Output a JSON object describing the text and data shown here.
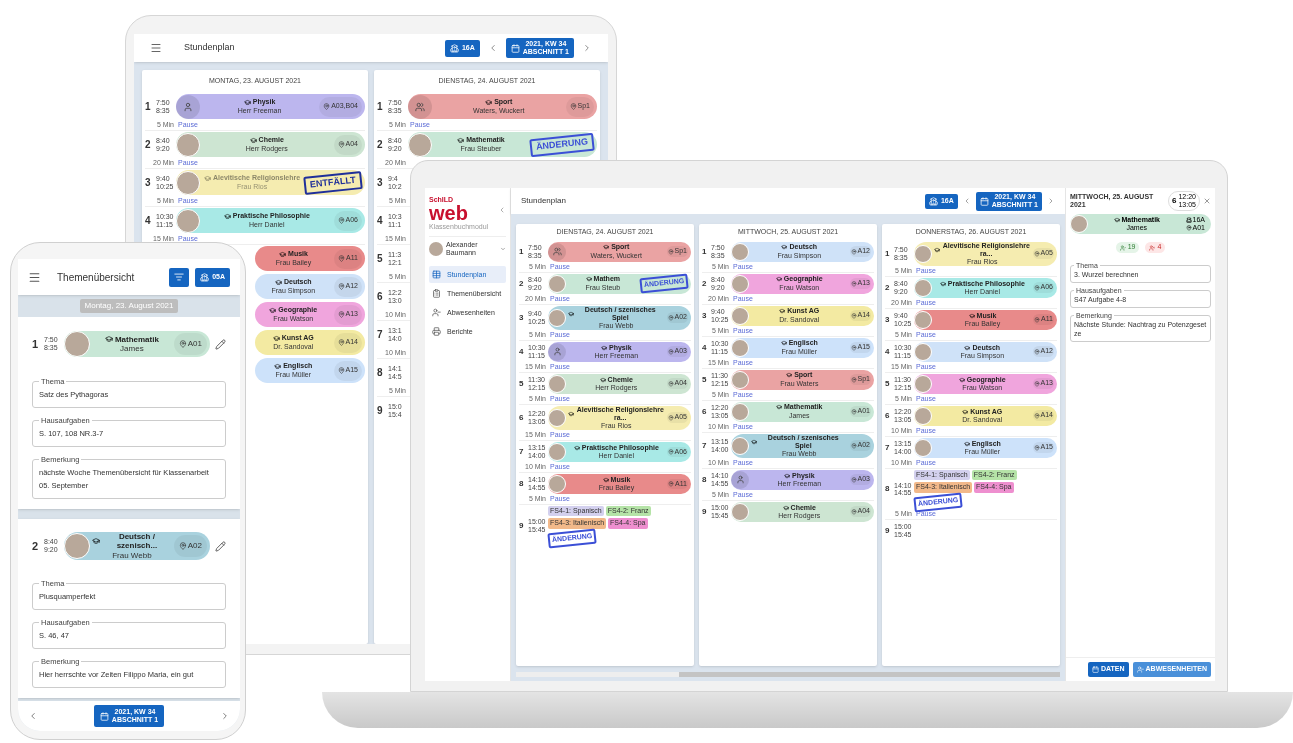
{
  "tablet": {
    "header": {
      "title": "Stundenplan",
      "class_button": "16A",
      "week_button": [
        "2021, KW 34",
        "ABSCHNITT 1"
      ]
    },
    "days": [
      {
        "title": "MONTAG, 23. AUGUST 2021",
        "entries": [
          {
            "kind": "lesson",
            "n": "1",
            "start": "7:50",
            "end": "8:35",
            "avatar": {
              "kind": "person"
            },
            "subject": "Physik",
            "teacher": "Herr Freeman",
            "room": "A03,B04",
            "color": "#bcb6ee"
          },
          {
            "kind": "pause",
            "duration": "5 Min",
            "label": "Pause"
          },
          {
            "kind": "lesson",
            "n": "2",
            "start": "8:40",
            "end": "9:20",
            "avatar": {
              "kind": "photo"
            },
            "subject": "Chemie",
            "teacher": "Herr Rodgers",
            "room": "A04",
            "color": "#cde5d2"
          },
          {
            "kind": "pause",
            "duration": "20 Min",
            "label": "Pause"
          },
          {
            "kind": "lesson",
            "n": "3",
            "start": "9:40",
            "end": "10:25",
            "avatar": {
              "kind": "photo"
            },
            "subject": "Alevitische Religionslehre",
            "teacher": "Frau Rios",
            "color": "#f5ecb0",
            "stamp": {
              "kind": "cancelled",
              "text": "ENTFÄLLT"
            }
          },
          {
            "kind": "pause",
            "duration": "5 Min",
            "label": "Pause"
          },
          {
            "kind": "lesson",
            "n": "4",
            "start": "10:30",
            "end": "11:15",
            "avatar": {
              "kind": "photo"
            },
            "subject": "Praktische Philosophie",
            "teacher": "Herr Daniel",
            "room": "A06",
            "color": "#a8e9e6"
          },
          {
            "kind": "pause",
            "duration": "15 Min",
            "label": "Pause"
          },
          {
            "kind": "lesson",
            "subject": "Musik",
            "teacher": "Frau Bailey",
            "room": "A11",
            "color": "#e88a8a"
          },
          {
            "kind": "lesson",
            "subject": "Deutsch",
            "teacher": "Frau Simpson",
            "room": "A12",
            "color": "#cfe2f8"
          },
          {
            "kind": "lesson",
            "subject": "Geographie",
            "teacher": "Frau Watson",
            "room": "A13",
            "color": "#f0a5dd"
          },
          {
            "kind": "lesson",
            "subject": "Kunst AG",
            "teacher": "Dr. Sandoval",
            "room": "A14",
            "color": "#f3eaa2"
          },
          {
            "kind": "lesson",
            "subject": "Englisch",
            "teacher": "Frau Müller",
            "room": "A15",
            "color": "#cde2fa"
          }
        ]
      },
      {
        "title": "DIENSTAG, 24. AUGUST 2021",
        "entries": [
          {
            "kind": "lesson",
            "n": "1",
            "start": "7:50",
            "end": "8:35",
            "avatar": {
              "kind": "group"
            },
            "subject": "Sport",
            "teacher": "Waters, Wuckert",
            "room": "Sp1",
            "color": "#eaa3a3"
          },
          {
            "kind": "pause",
            "duration": "5 Min",
            "label": "Pause"
          },
          {
            "kind": "lesson",
            "n": "2",
            "start": "8:40",
            "end": "9:20",
            "avatar": {
              "kind": "photo"
            },
            "subject": "Mathematik",
            "teacher": "Frau Steuber",
            "color": "#c8e7d6",
            "stamp": {
              "kind": "changed",
              "text": "ÄNDERUNG"
            }
          },
          {
            "kind": "pause",
            "duration": "20 Min"
          },
          {
            "kind": "lesson",
            "n": "3",
            "start": "9:4",
            "end": "10:2"
          },
          {
            "kind": "pause",
            "duration": "5 Min"
          },
          {
            "kind": "lesson",
            "n": "4",
            "start": "10:3",
            "end": "11:1"
          },
          {
            "kind": "pause",
            "duration": "15 Min"
          },
          {
            "kind": "lesson",
            "n": "5",
            "start": "11:3",
            "end": "12:1"
          },
          {
            "kind": "pause",
            "duration": "5 Min"
          },
          {
            "kind": "lesson",
            "n": "6",
            "start": "12:2",
            "end": "13:0"
          },
          {
            "kind": "pause",
            "duration": "10 Min"
          },
          {
            "kind": "lesson",
            "n": "7",
            "start": "13:1",
            "end": "14:0"
          },
          {
            "kind": "pause",
            "duration": "10 Min"
          },
          {
            "kind": "lesson",
            "n": "8",
            "start": "14:1",
            "end": "14:5"
          },
          {
            "kind": "pause",
            "duration": "5 Min"
          },
          {
            "kind": "lesson",
            "n": "9",
            "start": "15:0",
            "end": "15:4"
          }
        ]
      }
    ]
  },
  "phone": {
    "header": {
      "title": "Themenübersicht",
      "class_button": "05A"
    },
    "date": "Montag, 23. August 2021",
    "cards": [
      {
        "lesson": {
          "kind": "lesson",
          "n": "1",
          "start": "7:50",
          "end": "8:35",
          "avatar": {
            "kind": "photo"
          },
          "subject": "Mathematik",
          "teacher": "James",
          "room": "A01",
          "color": "#c8e7d6"
        },
        "fields": [
          {
            "label": "Thema",
            "value": "Satz des Pythagoras"
          },
          {
            "label": "Hausaufgaben",
            "value": "S. 107, 108 NR.3-7"
          },
          {
            "label": "Bemerkung",
            "value": "nächste Woche Themenübersicht für Klassenarbeit    05. September"
          }
        ]
      },
      {
        "lesson": {
          "kind": "lesson",
          "n": "2",
          "start": "8:40",
          "end": "9:20",
          "avatar": {
            "kind": "photo"
          },
          "subject": "Deutsch / szenisch...",
          "teacher": "Frau Webb",
          "room": "A02",
          "color": "#a9d2de"
        },
        "fields": [
          {
            "label": "Thema",
            "value": "Plusquamperfekt"
          },
          {
            "label": "Hausaufgaben",
            "value": "S. 46, 47"
          },
          {
            "label": "Bemerkung",
            "value": "Hier herrschte vor Zeiten Filippo Maria, ein gut"
          }
        ]
      }
    ],
    "week_button": [
      "2021, KW 34",
      "ABSCHNITT 1"
    ]
  },
  "laptop": {
    "sidebar": {
      "logo_small": "SchILD",
      "logo": "web",
      "subtitle": "Klassenbuchmodul",
      "user": "Alexander Baumann",
      "items": [
        {
          "label": "Stundenplan",
          "selected": true
        },
        {
          "label": "Themenübersicht",
          "selected": false
        },
        {
          "label": "Abwesenheiten",
          "selected": false
        },
        {
          "label": "Berichte",
          "selected": false
        }
      ]
    },
    "header": {
      "title": "Stundenplan",
      "class_button": "16A",
      "week_button": [
        "2021, KW 34",
        "ABSCHNITT 1"
      ]
    },
    "days": [
      {
        "title": "DIENSTAG, 24. AUGUST 2021",
        "entries": [
          {
            "kind": "lesson",
            "n": "1",
            "start": "7:50",
            "end": "8:35",
            "avatar": {
              "kind": "group"
            },
            "subject": "Sport",
            "teacher": "Waters, Wuckert",
            "room": "Sp1",
            "color": "#eaa3a3"
          },
          {
            "kind": "pause",
            "duration": "5 Min",
            "label": "Pause"
          },
          {
            "kind": "lesson",
            "n": "2",
            "start": "8:40",
            "end": "9:20",
            "avatar": {
              "kind": "photo"
            },
            "subject": "Mathem",
            "teacher": "Frau Steub",
            "color": "#c8e7d6",
            "stamp": {
              "kind": "changed",
              "text": "ÄNDERUNG"
            }
          },
          {
            "kind": "pause",
            "duration": "20 Min",
            "label": "Pause"
          },
          {
            "kind": "lesson",
            "n": "3",
            "start": "9:40",
            "end": "10:25",
            "avatar": {
              "kind": "photo"
            },
            "subject": "Deutsch / szenisches Spiel",
            "teacher": "Frau Webb",
            "room": "A02",
            "color": "#a9d2de"
          },
          {
            "kind": "pause",
            "duration": "5 Min",
            "label": "Pause"
          },
          {
            "kind": "lesson",
            "n": "4",
            "start": "10:30",
            "end": "11:15",
            "avatar": {
              "kind": "person"
            },
            "subject": "Physik",
            "teacher": "Herr Freeman",
            "room": "A03",
            "color": "#bcb6ee"
          },
          {
            "kind": "pause",
            "duration": "15 Min",
            "label": "Pause"
          },
          {
            "kind": "lesson",
            "n": "5",
            "start": "11:30",
            "end": "12:15",
            "avatar": {
              "kind": "photo"
            },
            "subject": "Chemie",
            "teacher": "Herr Rodgers",
            "room": "A04",
            "color": "#cde5d2"
          },
          {
            "kind": "pause",
            "duration": "5 Min",
            "label": "Pause"
          },
          {
            "kind": "lesson",
            "n": "6",
            "start": "12:20",
            "end": "13:05",
            "avatar": {
              "kind": "photo"
            },
            "subject": "Alevitische Religionslehre ra...",
            "teacher": "Frau Rios",
            "room": "A05",
            "color": "#f5ecb0"
          },
          {
            "kind": "pause",
            "duration": "15 Min",
            "label": "Pause"
          },
          {
            "kind": "lesson",
            "n": "7",
            "start": "13:15",
            "end": "14:00",
            "avatar": {
              "kind": "photo"
            },
            "subject": "Praktische Philosophie",
            "teacher": "Herr Daniel",
            "room": "A06",
            "color": "#a8e9e6"
          },
          {
            "kind": "pause",
            "duration": "10 Min",
            "label": "Pause"
          },
          {
            "kind": "lesson",
            "n": "8",
            "start": "14:10",
            "end": "14:55",
            "avatar": {
              "kind": "photo"
            },
            "subject": "Musik",
            "teacher": "Frau Bailey",
            "room": "A11",
            "color": "#e88a8a"
          },
          {
            "kind": "pause",
            "duration": "5 Min",
            "label": "Pause"
          },
          {
            "kind": "options",
            "n": "9",
            "start": "15:00",
            "end": "15:45",
            "chips": [
              {
                "text": "FS4-1: Spanisch",
                "color": "#d3d0ee"
              },
              {
                "text": "FS4-2: Franz",
                "color": "#b5e3a7"
              },
              {
                "text": "FS4-3: Italienisch",
                "color": "#f2b98a"
              },
              {
                "text": "FS4-4: Spa",
                "color": "#ee8fcf"
              }
            ],
            "stamp": {
              "kind": "changed",
              "text": "ÄNDERUNG"
            }
          }
        ]
      },
      {
        "title": "MITTWOCH, 25. AUGUST 2021",
        "entries": [
          {
            "kind": "lesson",
            "n": "1",
            "start": "7:50",
            "end": "8:35",
            "avatar": {
              "kind": "photo"
            },
            "subject": "Deutsch",
            "teacher": "Frau Simpson",
            "room": "A12",
            "color": "#cfe2f8"
          },
          {
            "kind": "pause",
            "duration": "5 Min",
            "label": "Pause"
          },
          {
            "kind": "lesson",
            "n": "2",
            "start": "8:40",
            "end": "9:20",
            "avatar": {
              "kind": "photo"
            },
            "subject": "Geographie",
            "teacher": "Frau Watson",
            "room": "A13",
            "color": "#f0a5dd"
          },
          {
            "kind": "pause",
            "duration": "20 Min",
            "label": "Pause"
          },
          {
            "kind": "lesson",
            "n": "3",
            "start": "9:40",
            "end": "10:25",
            "avatar": {
              "kind": "photo"
            },
            "subject": "Kunst AG",
            "teacher": "Dr. Sandoval",
            "room": "A14",
            "color": "#f3eaa2"
          },
          {
            "kind": "pause",
            "duration": "5 Min",
            "label": "Pause"
          },
          {
            "kind": "lesson",
            "n": "4",
            "start": "10:30",
            "end": "11:15",
            "avatar": {
              "kind": "photo"
            },
            "subject": "Englisch",
            "teacher": "Frau Müller",
            "room": "A15",
            "color": "#cde2fa"
          },
          {
            "kind": "pause",
            "duration": "15 Min",
            "label": "Pause"
          },
          {
            "kind": "lesson",
            "n": "5",
            "start": "11:30",
            "end": "12:15",
            "avatar": {
              "kind": "photo"
            },
            "subject": "Sport",
            "teacher": "Frau Waters",
            "room": "Sp1",
            "color": "#eaa3a3"
          },
          {
            "kind": "pause",
            "duration": "5 Min",
            "label": "Pause"
          },
          {
            "kind": "lesson",
            "n": "6",
            "start": "12:20",
            "end": "13:05",
            "avatar": {
              "kind": "photo"
            },
            "subject": "Mathematik",
            "teacher": "James",
            "room": "A01",
            "color": "#c8e7d6"
          },
          {
            "kind": "pause",
            "duration": "10 Min",
            "label": "Pause"
          },
          {
            "kind": "lesson",
            "n": "7",
            "start": "13:15",
            "end": "14:00",
            "avatar": {
              "kind": "photo"
            },
            "subject": "Deutsch / szenisches Spiel",
            "teacher": "Frau Webb",
            "room": "A02",
            "color": "#a9d2de"
          },
          {
            "kind": "pause",
            "duration": "10 Min",
            "label": "Pause"
          },
          {
            "kind": "lesson",
            "n": "8",
            "start": "14:10",
            "end": "14:55",
            "avatar": {
              "kind": "person"
            },
            "subject": "Physik",
            "teacher": "Herr Freeman",
            "room": "A03",
            "color": "#bcb6ee"
          },
          {
            "kind": "pause",
            "duration": "5 Min",
            "label": "Pause"
          },
          {
            "kind": "lesson",
            "n": "9",
            "start": "15:00",
            "end": "15:45",
            "avatar": {
              "kind": "photo"
            },
            "subject": "Chemie",
            "teacher": "Herr Rodgers",
            "room": "A04",
            "color": "#cde5d2"
          }
        ]
      },
      {
        "title": "DONNERSTAG, 26. AUGUST 2021",
        "entries": [
          {
            "kind": "lesson",
            "n": "1",
            "start": "7:50",
            "end": "8:35",
            "avatar": {
              "kind": "photo"
            },
            "subject": "Alevitische Religionslehre ra...",
            "teacher": "Frau Rios",
            "room": "A05",
            "color": "#f5ecb0"
          },
          {
            "kind": "pause",
            "duration": "5 Min",
            "label": "Pause"
          },
          {
            "kind": "lesson",
            "n": "2",
            "start": "8:40",
            "end": "9:20",
            "avatar": {
              "kind": "photo"
            },
            "subject": "Praktische Philosophie",
            "teacher": "Herr Daniel",
            "room": "A06",
            "color": "#a8e9e6"
          },
          {
            "kind": "pause",
            "duration": "20 Min",
            "label": "Pause"
          },
          {
            "kind": "lesson",
            "n": "3",
            "start": "9:40",
            "end": "10:25",
            "avatar": {
              "kind": "photo"
            },
            "subject": "Musik",
            "teacher": "Frau Bailey",
            "room": "A11",
            "color": "#e88a8a"
          },
          {
            "kind": "pause",
            "duration": "5 Min",
            "label": "Pause"
          },
          {
            "kind": "lesson",
            "n": "4",
            "start": "10:30",
            "end": "11:15",
            "avatar": {
              "kind": "photo"
            },
            "subject": "Deutsch",
            "teacher": "Frau Simpson",
            "room": "A12",
            "color": "#cfe2f8"
          },
          {
            "kind": "pause",
            "duration": "15 Min",
            "label": "Pause"
          },
          {
            "kind": "lesson",
            "n": "5",
            "start": "11:30",
            "end": "12:15",
            "avatar": {
              "kind": "photo"
            },
            "subject": "Geographie",
            "teacher": "Frau Watson",
            "room": "A13",
            "color": "#f0a5dd"
          },
          {
            "kind": "pause",
            "duration": "5 Min",
            "label": "Pause"
          },
          {
            "kind": "lesson",
            "n": "6",
            "start": "12:20",
            "end": "13:05",
            "avatar": {
              "kind": "photo"
            },
            "subject": "Kunst AG",
            "teacher": "Dr. Sandoval",
            "room": "A14",
            "color": "#f3eaa2"
          },
          {
            "kind": "pause",
            "duration": "10 Min",
            "label": "Pause"
          },
          {
            "kind": "lesson",
            "n": "7",
            "start": "13:15",
            "end": "14:00",
            "avatar": {
              "kind": "photo"
            },
            "subject": "Englisch",
            "teacher": "Frau Müller",
            "room": "A15",
            "color": "#cde2fa"
          },
          {
            "kind": "pause",
            "duration": "10 Min",
            "label": "Pause"
          },
          {
            "kind": "options",
            "n": "8",
            "start": "14:10",
            "end": "14:55",
            "chips": [
              {
                "text": "FS4-1: Spanisch",
                "color": "#d3d0ee"
              },
              {
                "text": "FS4-2: Franz",
                "color": "#b5e3a7"
              },
              {
                "text": "FS4-3: Italienisch",
                "color": "#f2b98a"
              },
              {
                "text": "FS4-4: Spa",
                "color": "#ee8fcf"
              }
            ],
            "stamp": {
              "kind": "changed",
              "text": "ÄNDERUNG"
            }
          },
          {
            "kind": "pause",
            "duration": "5 Min",
            "label": "Pause"
          },
          {
            "kind": "empty",
            "n": "9",
            "start": "15:00",
            "end": "15:45"
          }
        ]
      }
    ],
    "detail": {
      "title": "MITTWOCH, 25. AUGUST 2021",
      "period": "6",
      "start": "12:20",
      "end": "13:05",
      "lesson": {
        "subject": "Mathematik",
        "teacher": "James",
        "class": "16A",
        "room": "A01",
        "color": "#c8e7d6"
      },
      "present": "19",
      "absent": "4",
      "fields": [
        {
          "label": "Thema",
          "value": "3. Wurzel berechnen"
        },
        {
          "label": "Hausaufgaben",
          "value": "S47 Aufgabe 4-8"
        },
        {
          "label": "Bemerkung",
          "value": "Nächste Stunde: Nachtrag zu Potenzgesetze"
        }
      ],
      "buttons": [
        "DATEN",
        "ABWESENHEITEN"
      ]
    }
  }
}
